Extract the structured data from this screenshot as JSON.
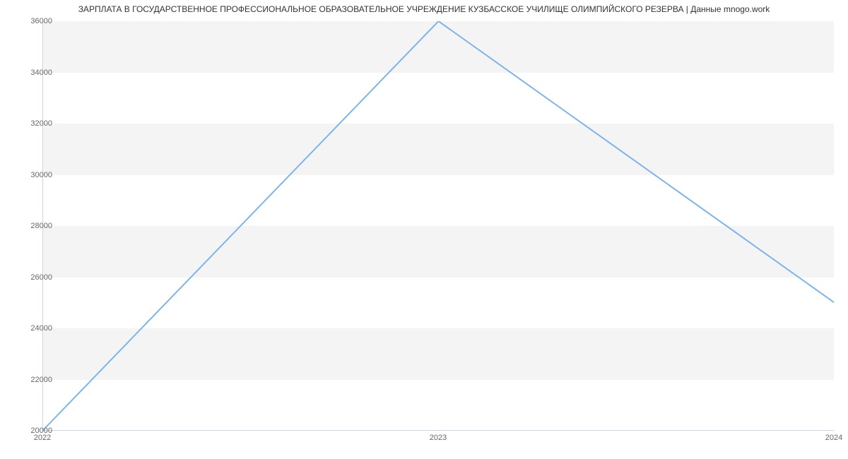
{
  "title": "ЗАРПЛАТА В ГОСУДАРСТВЕННОЕ ПРОФЕССИОНАЛЬНОЕ ОБРАЗОВАТЕЛЬНОЕ УЧРЕЖДЕНИЕ КУЗБАССКОЕ УЧИЛИЩЕ ОЛИМПИЙСКОГО РЕЗЕРВА | Данные mnogo.work",
  "chart_data": {
    "type": "line",
    "x": [
      "2022",
      "2023",
      "2024"
    ],
    "values": [
      20000,
      36000,
      25000
    ],
    "y_ticks": [
      20000,
      22000,
      24000,
      26000,
      28000,
      30000,
      32000,
      34000,
      36000
    ],
    "ylim": [
      20000,
      36000
    ],
    "xlabel": "",
    "ylabel": "",
    "grid_bands": true,
    "line_color": "#7cb5ec"
  }
}
